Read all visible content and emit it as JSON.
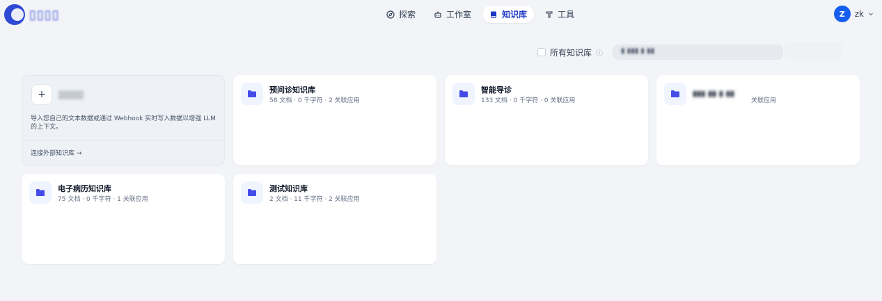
{
  "nav": {
    "items": [
      {
        "label": "探索",
        "active": false
      },
      {
        "label": "工作室",
        "active": false
      },
      {
        "label": "知识库",
        "active": true
      },
      {
        "label": "工具",
        "active": false
      }
    ]
  },
  "user": {
    "initial": "Z",
    "name": "zk"
  },
  "filter": {
    "all_label": "所有知识库"
  },
  "create_card": {
    "plus": "+",
    "description": "导入您自己的文本数据或通过 Webhook 实时写入数据以增强 LLM 的上下文。",
    "connect_link": "连接外部知识库 →"
  },
  "knowledge_bases": [
    {
      "name": "预问诊知识库",
      "meta": "58 文档 · 0 千字符 · 2 关联应用"
    },
    {
      "name": "智能导诊",
      "meta": "133 文档 · 0 千字符 · 0 关联应用"
    },
    {
      "name": "",
      "meta": "关联应用"
    },
    {
      "name": "电子病历知识库",
      "meta": "75 文档 · 0 千字符 · 1 关联应用"
    },
    {
      "name": "测试知识库",
      "meta": "2 文档 · 11 千字符 · 2 关联应用"
    }
  ],
  "colors": {
    "accent": "#1d39c4",
    "avatar": "#155eef",
    "folder": "#444ce7"
  }
}
